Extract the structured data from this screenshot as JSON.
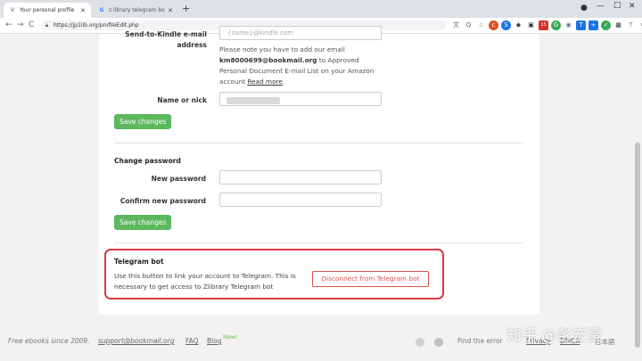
{
  "browser": {
    "tabs": [
      {
        "icon": "V",
        "title": "Your personal profile"
      },
      {
        "icon": "G",
        "title": "z library telegram bot daily cl..."
      }
    ],
    "new_tab": "+",
    "window_controls": {
      "minimize": "—",
      "maximize": "□",
      "close": "✕"
    },
    "nav": {
      "back": "←",
      "forward": "→",
      "reload": "C"
    },
    "url": "https://jp1lib.org/profileEdit.php",
    "extensions": [
      {
        "icon": "translate-icon",
        "glyph": "文",
        "color": "#5f6368"
      },
      {
        "icon": "zoom-icon",
        "glyph": "Q",
        "color": "#5f6368"
      },
      {
        "icon": "star-icon",
        "glyph": "☆",
        "color": "#5f6368"
      },
      {
        "icon": "c-icon",
        "glyph": "c",
        "color": "#e34c26"
      },
      {
        "icon": "s-icon",
        "glyph": "S",
        "color": "#1a73e8"
      },
      {
        "icon": "ext-icon",
        "glyph": "◆",
        "color": "#444"
      },
      {
        "icon": "rss-icon",
        "glyph": "▣",
        "color": "#333"
      },
      {
        "icon": "mail-badge-icon",
        "glyph": "15",
        "color": "#d93025"
      },
      {
        "icon": "g-icon",
        "glyph": "G",
        "color": "#34a853"
      },
      {
        "icon": "ext2-icon",
        "glyph": "◉",
        "color": "#607d8b"
      },
      {
        "icon": "t-icon",
        "glyph": "T",
        "color": "#1a73e8"
      },
      {
        "icon": "plus-icon",
        "glyph": "+",
        "color": "#1a73e8"
      },
      {
        "icon": "check-icon",
        "glyph": "✓",
        "color": "#34a853"
      },
      {
        "icon": "grid-icon",
        "glyph": "▦",
        "color": "#333"
      },
      {
        "icon": "t2-icon",
        "glyph": "T",
        "color": "#888"
      },
      {
        "icon": "puzzle-icon",
        "glyph": "⚙",
        "color": "#5f6368"
      },
      {
        "icon": "avatar-icon",
        "glyph": "●",
        "color": "#8d6e63"
      },
      {
        "icon": "menu-icon",
        "glyph": "⋮",
        "color": "#5f6368"
      }
    ]
  },
  "form": {
    "kindle_label": "Send-to-Kindle e-mail address",
    "kindle_placeholder": "{name}@kindle.com",
    "note_prefix": "Please note you have to add our email ",
    "note_email": "km8000699@bookmail.org",
    "note_middle": " to Approved Personal Document E-mail List on your Amazon account ",
    "note_link": "Read more",
    "note_suffix": ".",
    "nick_label": "Name or nick",
    "save_label": "Save changes",
    "password_section": "Change password",
    "new_password_label": "New password",
    "confirm_password_label": "Confirm new password",
    "save_label_2": "Save changes"
  },
  "telegram": {
    "title": "Telegram bot",
    "description": "Use this button to link your account to Telegram. This is necessary to get access to Zlibrary Telegram bot",
    "button": "Disconnect from Telegram bot"
  },
  "footer": {
    "tagline": "Free ebooks since 2009.",
    "email": "support@bookmail.org",
    "faq": "FAQ",
    "blog": "Blog",
    "new_badge": "New!",
    "find_error": "Find the error",
    "privacy": "Privacy",
    "dmca": "DMCA",
    "language": "日本語"
  },
  "watermark": "知乎 @彭宏豪"
}
